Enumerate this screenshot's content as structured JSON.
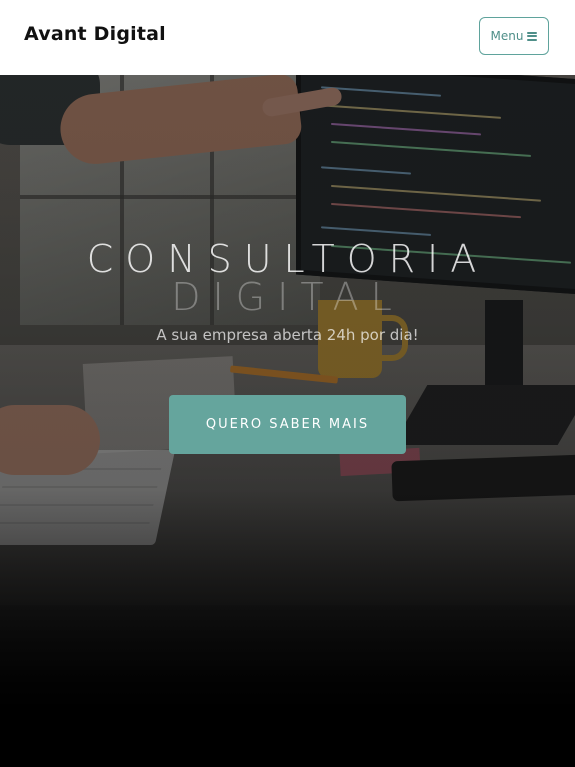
{
  "navbar": {
    "brand": "Avant Digital",
    "menu_label": "Menu",
    "menu_icon": "bars-icon"
  },
  "hero": {
    "title_line1": "CONSULTORIA",
    "title_line2": "DIGITAL",
    "subtitle": "A sua empresa aberta 24h por dia!",
    "cta_label": "QUERO SABER MAIS"
  },
  "colors": {
    "accent": "#65a59d",
    "menu_border": "#5fa39c",
    "nav_background": "#ffffff",
    "brand_text": "#111111"
  }
}
